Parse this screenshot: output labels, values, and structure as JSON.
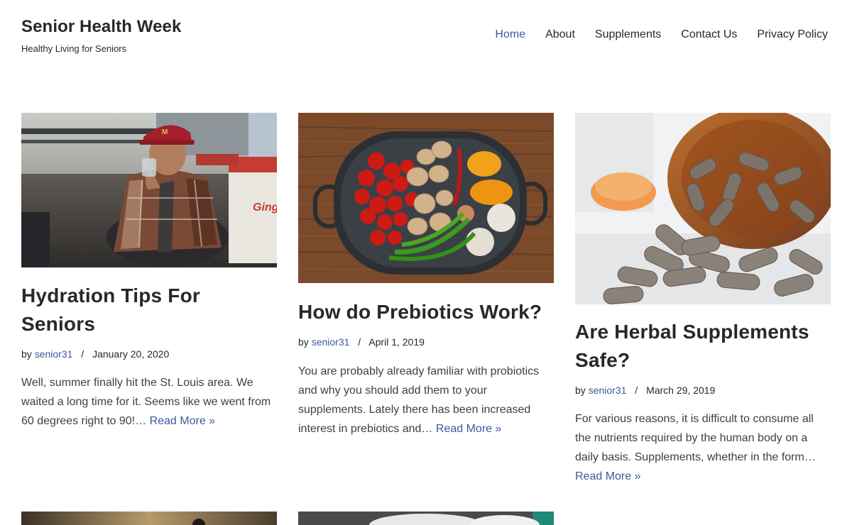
{
  "site": {
    "title": "Senior Health Week",
    "tagline": "Healthy Living for Seniors"
  },
  "nav": {
    "items": [
      "Home",
      "About",
      "Supplements",
      "Contact Us",
      "Privacy Policy"
    ],
    "active": "Home"
  },
  "colors": {
    "accent": "#3c5a99",
    "text": "#282828"
  },
  "posts": [
    {
      "title": "Hydration Tips For Seniors",
      "by": "by",
      "author": "senior31",
      "separator": "/",
      "date": "January 20, 2020",
      "excerpt": "Well, summer finally hit the St. Louis area. We waited a long time for it. Seems like we went from 60 degrees right to 90!…",
      "read_more": "Read More »"
    },
    {
      "title": "How do Prebiotics Work?",
      "by": "by",
      "author": "senior31",
      "separator": "/",
      "date": "April 1, 2019",
      "excerpt": "You are probably already familiar with probiotics and why you should add them to your supplements.  Lately there has been increased interest in prebiotics and…",
      "read_more": "Read More »"
    },
    {
      "title": "Are Herbal Supplements Safe?",
      "by": "by",
      "author": "senior31",
      "separator": "/",
      "date": "March 29, 2019",
      "excerpt": "For various reasons, it is difficult to consume all the nutrients required by the human body on a daily basis. Supplements, whether in the form…",
      "read_more": "Read More »"
    }
  ]
}
